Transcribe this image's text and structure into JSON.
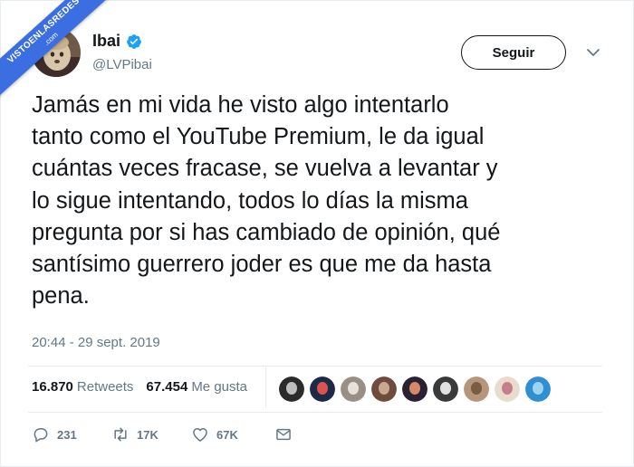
{
  "watermark": {
    "line1": "VISTOENLASREDES",
    "line2": ".com"
  },
  "author": {
    "name": "Ibai",
    "handle": "@LVPibai",
    "verified": true
  },
  "follow_button": {
    "label": "Seguir"
  },
  "tweet": {
    "text": "Jamás en mi vida he visto algo intentarlo\ntanto como el YouTube Premium, le da igual\ncuántas veces fracase, se vuelva a levantar y\nlo sigue intentando, todos lo días la misma\npregunta por si has cambiado de opinión, qué\nsantísimo guerrero joder es que me da hasta\npena.",
    "timestamp": "20:44 - 29 sept. 2019"
  },
  "stats": {
    "retweets_count": "16.870",
    "retweets_label": "Retweets",
    "likes_count": "67.454",
    "likes_label": "Me gusta"
  },
  "likers": [
    {
      "color": "#2b2b2b",
      "accent": "#bfbfbf"
    },
    {
      "color": "#1c2a48",
      "accent": "#d9534f"
    },
    {
      "color": "#9a8f86",
      "accent": "#e8e1d9"
    },
    {
      "color": "#6e4b3c",
      "accent": "#c9a98e"
    },
    {
      "color": "#2a2233",
      "accent": "#d48a6a"
    },
    {
      "color": "#3a3a3a",
      "accent": "#e2e2e2"
    },
    {
      "color": "#b5967a",
      "accent": "#7a5b43"
    },
    {
      "color": "#e9dccf",
      "accent": "#c77e8b"
    },
    {
      "color": "#2f8fd1",
      "accent": "#9fd3f2"
    }
  ],
  "actions": {
    "reply_count": "231",
    "retweet_count": "17K",
    "like_count": "67K"
  },
  "colors": {
    "text": "#14171a",
    "secondary": "#657786",
    "border": "#e6ecf0",
    "verified": "#1da1f2",
    "ribbon": "#3b6ee0"
  }
}
